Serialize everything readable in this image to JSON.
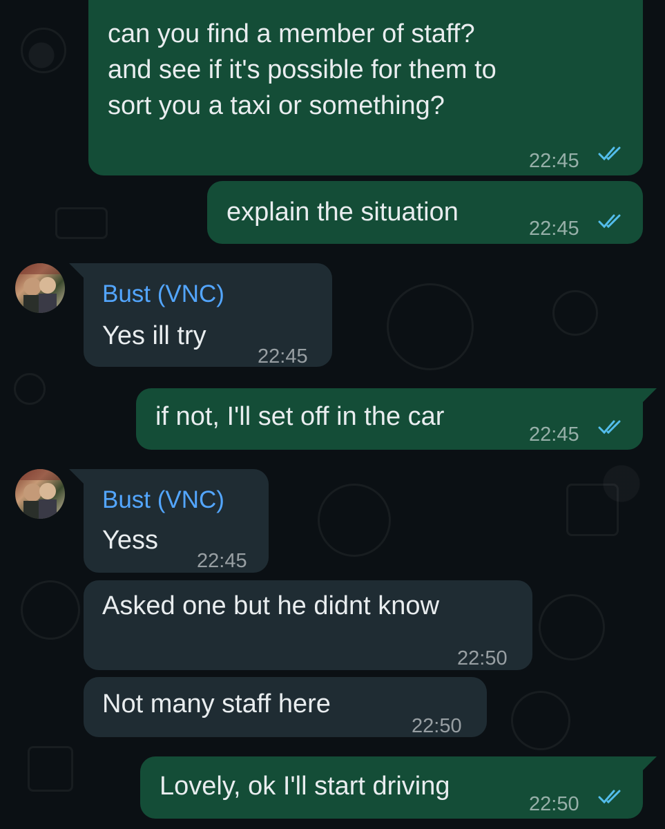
{
  "messages": [
    {
      "id": "m1",
      "direction": "outgoing",
      "lines": [
        "can you find a member of staff?",
        "and see if it's possible for them to",
        "sort you a taxi or something?"
      ],
      "time": "22:45",
      "status": "read"
    },
    {
      "id": "m2",
      "direction": "outgoing",
      "text": "explain the situation",
      "time": "22:45",
      "status": "read"
    },
    {
      "id": "m3",
      "direction": "incoming",
      "sender": "Bust (VNC)",
      "text": "Yes ill try",
      "time": "22:45"
    },
    {
      "id": "m4",
      "direction": "outgoing",
      "text": "if not, I'll set off in the car",
      "time": "22:45",
      "status": "read"
    },
    {
      "id": "m5",
      "direction": "incoming",
      "sender": "Bust (VNC)",
      "text": "Yess",
      "time": "22:45"
    },
    {
      "id": "m6",
      "direction": "incoming",
      "text": "Asked one but he didnt know",
      "time": "22:50"
    },
    {
      "id": "m7",
      "direction": "incoming",
      "text": "Not many staff here",
      "time": "22:50"
    },
    {
      "id": "m8",
      "direction": "outgoing",
      "text": "Lovely, ok I'll start driving",
      "time": "22:50",
      "status": "read"
    }
  ],
  "icons": {
    "read_receipt": "double-check-icon",
    "avatar": "contact-avatar"
  },
  "colors": {
    "background": "#0b1014",
    "outgoing_bubble": "#144d37",
    "incoming_bubble": "#1f2c33",
    "sender_name": "#53a6ff",
    "read_ticks": "#53bdeb",
    "text": "#e9edef"
  }
}
